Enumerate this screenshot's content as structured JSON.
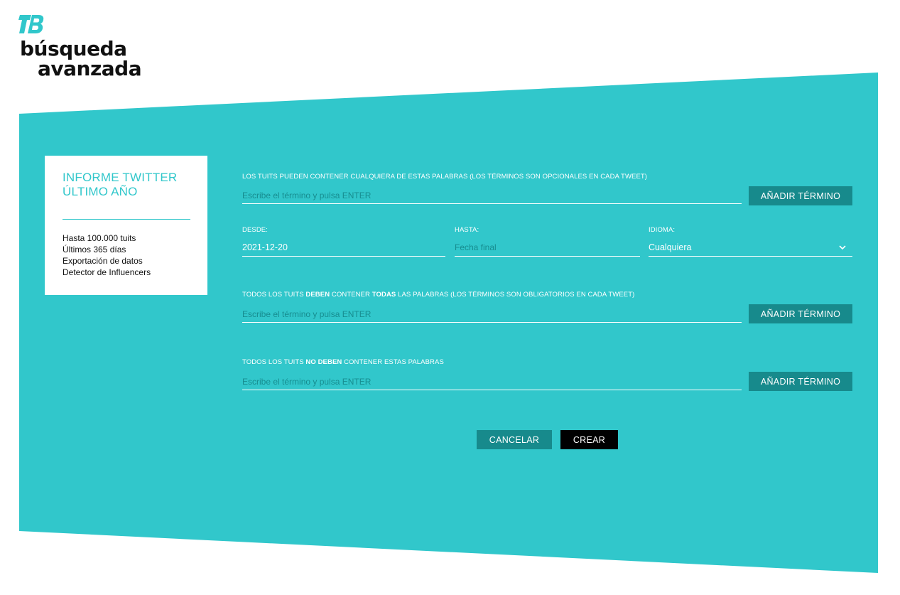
{
  "brand": {
    "line1": "búsqueda",
    "line2": "avanzada",
    "accent_color": "#31c7cb",
    "dark_teal": "#178a8c"
  },
  "info_card": {
    "title_line1": "INFORME TWITTER",
    "title_line2": "ÚLTIMO AÑO",
    "features": [
      "Hasta 100.000 tuits",
      "Últimos 365 días",
      "Exportación de datos",
      "Detector de Influencers"
    ]
  },
  "any_words": {
    "label": "LOS TUITS PUEDEN CONTENER CUALQUIERA DE ESTAS PALABRAS (LOS TÉRMINOS SON OPCIONALES EN CADA TWEET)",
    "placeholder": "Escribe el término y pulsa ENTER",
    "button": "AÑADIR TÉRMINO"
  },
  "dates": {
    "from_label": "DESDE:",
    "from_value": "2021-12-20",
    "to_label": "HASTA:",
    "to_placeholder": "Fecha final",
    "lang_label": "IDIOMA:",
    "lang_value": "Cualquiera"
  },
  "all_words": {
    "label_pre": "TODOS LOS TUITS ",
    "label_b1": "DEBEN",
    "label_mid": " CONTENER ",
    "label_b2": "TODAS",
    "label_post": " LAS PALABRAS (LOS TÉRMINOS SON OBLIGATORIOS EN CADA TWEET)",
    "placeholder": "Escribe el término y pulsa ENTER",
    "button": "AÑADIR TÉRMINO"
  },
  "none_words": {
    "label_pre": "TODOS LOS TUITS ",
    "label_b1": "NO DEBEN",
    "label_post": " CONTENER ESTAS PALABRAS",
    "placeholder": "Escribe el término y pulsa ENTER",
    "button": "AÑADIR TÉRMINO"
  },
  "actions": {
    "cancel": "CANCELAR",
    "create": "CREAR"
  }
}
